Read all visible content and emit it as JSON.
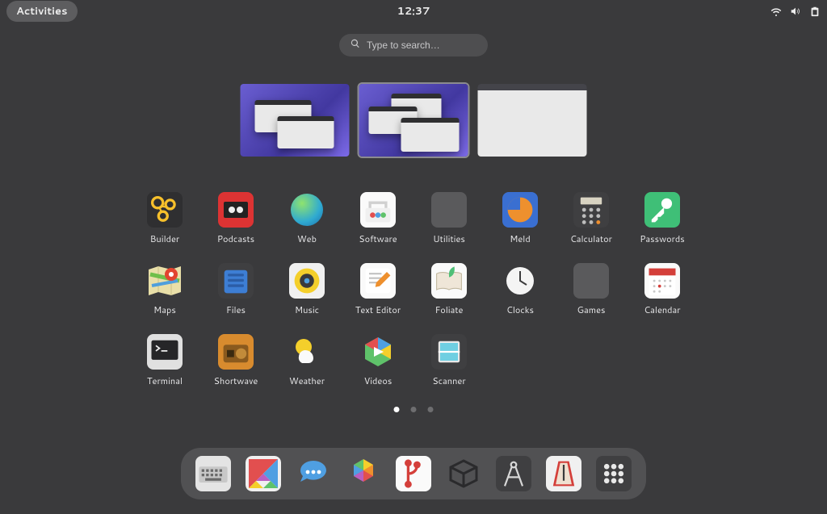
{
  "topbar": {
    "activities": "Activities",
    "clock": "12:37"
  },
  "search": {
    "placeholder": "Type to search…"
  },
  "workspaces": [
    {
      "type": "populated",
      "selected": false
    },
    {
      "type": "populated",
      "selected": true
    },
    {
      "type": "blank",
      "selected": false
    }
  ],
  "apps": [
    {
      "id": "builder",
      "label": "Builder"
    },
    {
      "id": "podcasts",
      "label": "Podcasts"
    },
    {
      "id": "web",
      "label": "Web"
    },
    {
      "id": "software",
      "label": "Software"
    },
    {
      "id": "utilities",
      "label": "Utilities",
      "folder": true
    },
    {
      "id": "meld",
      "label": "Meld"
    },
    {
      "id": "calculator",
      "label": "Calculator"
    },
    {
      "id": "passwords",
      "label": "Passwords"
    },
    {
      "id": "maps",
      "label": "Maps"
    },
    {
      "id": "files",
      "label": "Files"
    },
    {
      "id": "music",
      "label": "Music"
    },
    {
      "id": "texteditor",
      "label": "Text Editor"
    },
    {
      "id": "foliate",
      "label": "Foliate"
    },
    {
      "id": "clocks",
      "label": "Clocks"
    },
    {
      "id": "games",
      "label": "Games",
      "folder": true
    },
    {
      "id": "calendar",
      "label": "Calendar"
    },
    {
      "id": "terminal",
      "label": "Terminal"
    },
    {
      "id": "shortwave",
      "label": "Shortwave"
    },
    {
      "id": "weather",
      "label": "Weather"
    },
    {
      "id": "videos",
      "label": "Videos"
    },
    {
      "id": "scanner",
      "label": "Scanner"
    }
  ],
  "pages": {
    "count": 3,
    "current": 0
  },
  "dash": [
    {
      "id": "keyboard"
    },
    {
      "id": "tangram"
    },
    {
      "id": "chat"
    },
    {
      "id": "photos"
    },
    {
      "id": "gitg"
    },
    {
      "id": "boxes"
    },
    {
      "id": "compass"
    },
    {
      "id": "metronome"
    },
    {
      "id": "appgrid"
    }
  ]
}
